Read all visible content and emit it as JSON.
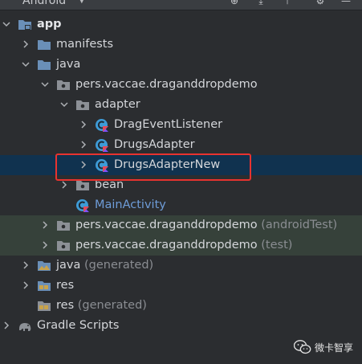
{
  "toolbar": {
    "view_selector": "Android"
  },
  "tree": [
    {
      "label": "app",
      "suffix": "",
      "depth": 0,
      "expanded": true,
      "icon": "module-folder-icon",
      "style": "bold",
      "row": ""
    },
    {
      "label": "manifests",
      "suffix": "",
      "depth": 1,
      "expanded": false,
      "icon": "folder-icon",
      "style": "",
      "row": ""
    },
    {
      "label": "java",
      "suffix": "",
      "depth": 1,
      "expanded": true,
      "icon": "folder-icon",
      "style": "",
      "row": ""
    },
    {
      "label": "pers.vaccae.draganddropdemo",
      "suffix": "",
      "depth": 2,
      "expanded": true,
      "icon": "package-icon",
      "style": "",
      "row": ""
    },
    {
      "label": "adapter",
      "suffix": "",
      "depth": 3,
      "expanded": true,
      "icon": "package-icon",
      "style": "",
      "row": ""
    },
    {
      "label": "DragEventListener",
      "suffix": "",
      "depth": 4,
      "expanded": false,
      "icon": "kotlin-class-icon",
      "style": "",
      "row": ""
    },
    {
      "label": "DrugsAdapter",
      "suffix": "",
      "depth": 4,
      "expanded": false,
      "icon": "kotlin-class-icon",
      "style": "",
      "row": ""
    },
    {
      "label": "DrugsAdapterNew",
      "suffix": "",
      "depth": 4,
      "expanded": false,
      "icon": "kotlin-class-icon",
      "style": "",
      "row": "selected"
    },
    {
      "label": "bean",
      "suffix": "",
      "depth": 3,
      "expanded": false,
      "icon": "package-icon",
      "style": "",
      "row": ""
    },
    {
      "label": "MainActivity",
      "suffix": "",
      "depth": 3,
      "expanded": null,
      "icon": "kotlin-class-icon",
      "style": "link",
      "row": ""
    },
    {
      "label": "pers.vaccae.draganddropdemo",
      "suffix": " (androidTest)",
      "depth": 2,
      "expanded": false,
      "icon": "package-icon",
      "style": "",
      "row": "tinted"
    },
    {
      "label": "pers.vaccae.draganddropdemo",
      "suffix": " (test)",
      "depth": 2,
      "expanded": false,
      "icon": "package-icon",
      "style": "",
      "row": "tinted"
    },
    {
      "label": "java",
      "suffix": " (generated)",
      "depth": 1,
      "expanded": false,
      "icon": "generated-folder-icon",
      "style": "",
      "row": ""
    },
    {
      "label": "res",
      "suffix": "",
      "depth": 1,
      "expanded": false,
      "icon": "res-folder-icon",
      "style": "",
      "row": ""
    },
    {
      "label": "res",
      "suffix": " (generated)",
      "depth": 1,
      "expanded": null,
      "icon": "res-generated-folder-icon",
      "style": "",
      "row": ""
    },
    {
      "label": "Gradle Scripts",
      "suffix": "",
      "depth": 0,
      "expanded": false,
      "icon": "gradle-elephant-icon",
      "style": "",
      "row": ""
    }
  ],
  "watermark": {
    "text": "微卡智享",
    "icon": "wechat-icon"
  },
  "colors": {
    "background": "#2b2d30",
    "selected_row": "#10324f",
    "test_row": "#36413a",
    "folder_blue": "#6a8fb8",
    "kotlin_class": "#3e9bd6",
    "highlight_red": "#e8332f",
    "link_text": "#6e9cd8"
  }
}
